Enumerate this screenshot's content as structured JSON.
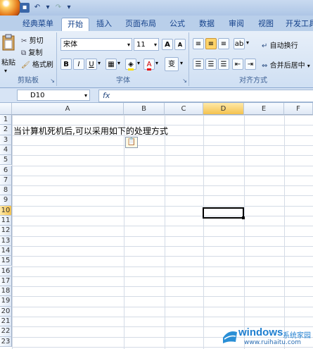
{
  "qat": {
    "icons": [
      "save-icon",
      "undo-icon",
      "redo-icon"
    ]
  },
  "tabs": [
    {
      "label": "经典菜单",
      "active": false
    },
    {
      "label": "开始",
      "active": true
    },
    {
      "label": "插入",
      "active": false
    },
    {
      "label": "页面布局",
      "active": false
    },
    {
      "label": "公式",
      "active": false
    },
    {
      "label": "数据",
      "active": false
    },
    {
      "label": "审阅",
      "active": false
    },
    {
      "label": "视图",
      "active": false
    },
    {
      "label": "开发工具",
      "active": false
    }
  ],
  "clipboard": {
    "paste": "粘贴",
    "cut": "剪切",
    "copy": "复制",
    "format_painter": "格式刷",
    "group_label": "剪贴板"
  },
  "font": {
    "name": "宋体",
    "size": "11",
    "group_label": "字体",
    "bold": "B",
    "italic": "I",
    "underline": "U",
    "grow": "A",
    "shrink": "A",
    "phonetic": "变"
  },
  "alignment": {
    "wrap": "自动换行",
    "merge": "合并后居中",
    "group_label": "对齐方式"
  },
  "formula_bar": {
    "name_box": "D10",
    "fx": "fx",
    "content": ""
  },
  "sheet": {
    "columns": [
      "A",
      "B",
      "C",
      "D",
      "E",
      "F"
    ],
    "selected_column": "D",
    "rows": [
      "1",
      "2",
      "3",
      "4",
      "5",
      "6",
      "7",
      "8",
      "9",
      "10",
      "11",
      "12",
      "13",
      "14",
      "15",
      "16",
      "17",
      "18",
      "19",
      "20",
      "21",
      "22",
      "23"
    ],
    "selected_row": "10",
    "cell_A2": "当计算机死机后,可以采用如下的处理方式"
  },
  "watermark": {
    "brand": "windows",
    "suffix": "系统家园",
    "url": "www.ruihaitu.com"
  },
  "colors": {
    "accent": "#15428b",
    "selection": "#f4c24f"
  }
}
